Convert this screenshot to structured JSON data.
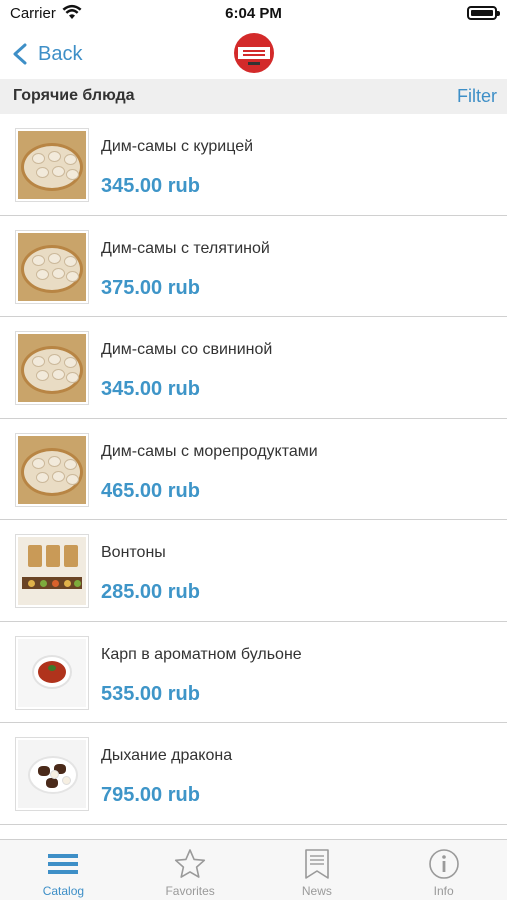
{
  "status": {
    "carrier": "Carrier",
    "time": "6:04 PM"
  },
  "nav": {
    "back_label": "Back",
    "logo_icon": "restaurant-logo-icon"
  },
  "section": {
    "title": "Горячие блюда",
    "filter_label": "Filter"
  },
  "items": [
    {
      "name": "Дим-самы с курицей",
      "price": "345.00 rub",
      "image": "dim-sum-steamer"
    },
    {
      "name": "Дим-самы с телятиной",
      "price": "375.00 rub",
      "image": "dim-sum-steamer"
    },
    {
      "name": "Дим-самы со свининой",
      "price": "345.00 rub",
      "image": "dim-sum-steamer"
    },
    {
      "name": "Дим-самы с морепродуктами",
      "price": "465.00 rub",
      "image": "dim-sum-steamer"
    },
    {
      "name": "Вонтоны",
      "price": "285.00 rub",
      "image": "wontons"
    },
    {
      "name": "Карп в ароматном бульоне",
      "price": "535.00 rub",
      "image": "soup-bowl"
    },
    {
      "name": "Дыхание дракона",
      "price": "795.00 rub",
      "image": "dragon-plate"
    }
  ],
  "tabs": [
    {
      "label": "Catalog",
      "icon": "catalog-icon",
      "active": true
    },
    {
      "label": "Favorites",
      "icon": "star-icon",
      "active": false
    },
    {
      "label": "News",
      "icon": "bookmark-icon",
      "active": false
    },
    {
      "label": "Info",
      "icon": "info-icon",
      "active": false
    }
  ],
  "colors": {
    "accent": "#3e8fc7",
    "price": "#3e95c8",
    "section_bg": "#efefef",
    "tab_inactive": "#9a9a9a"
  }
}
